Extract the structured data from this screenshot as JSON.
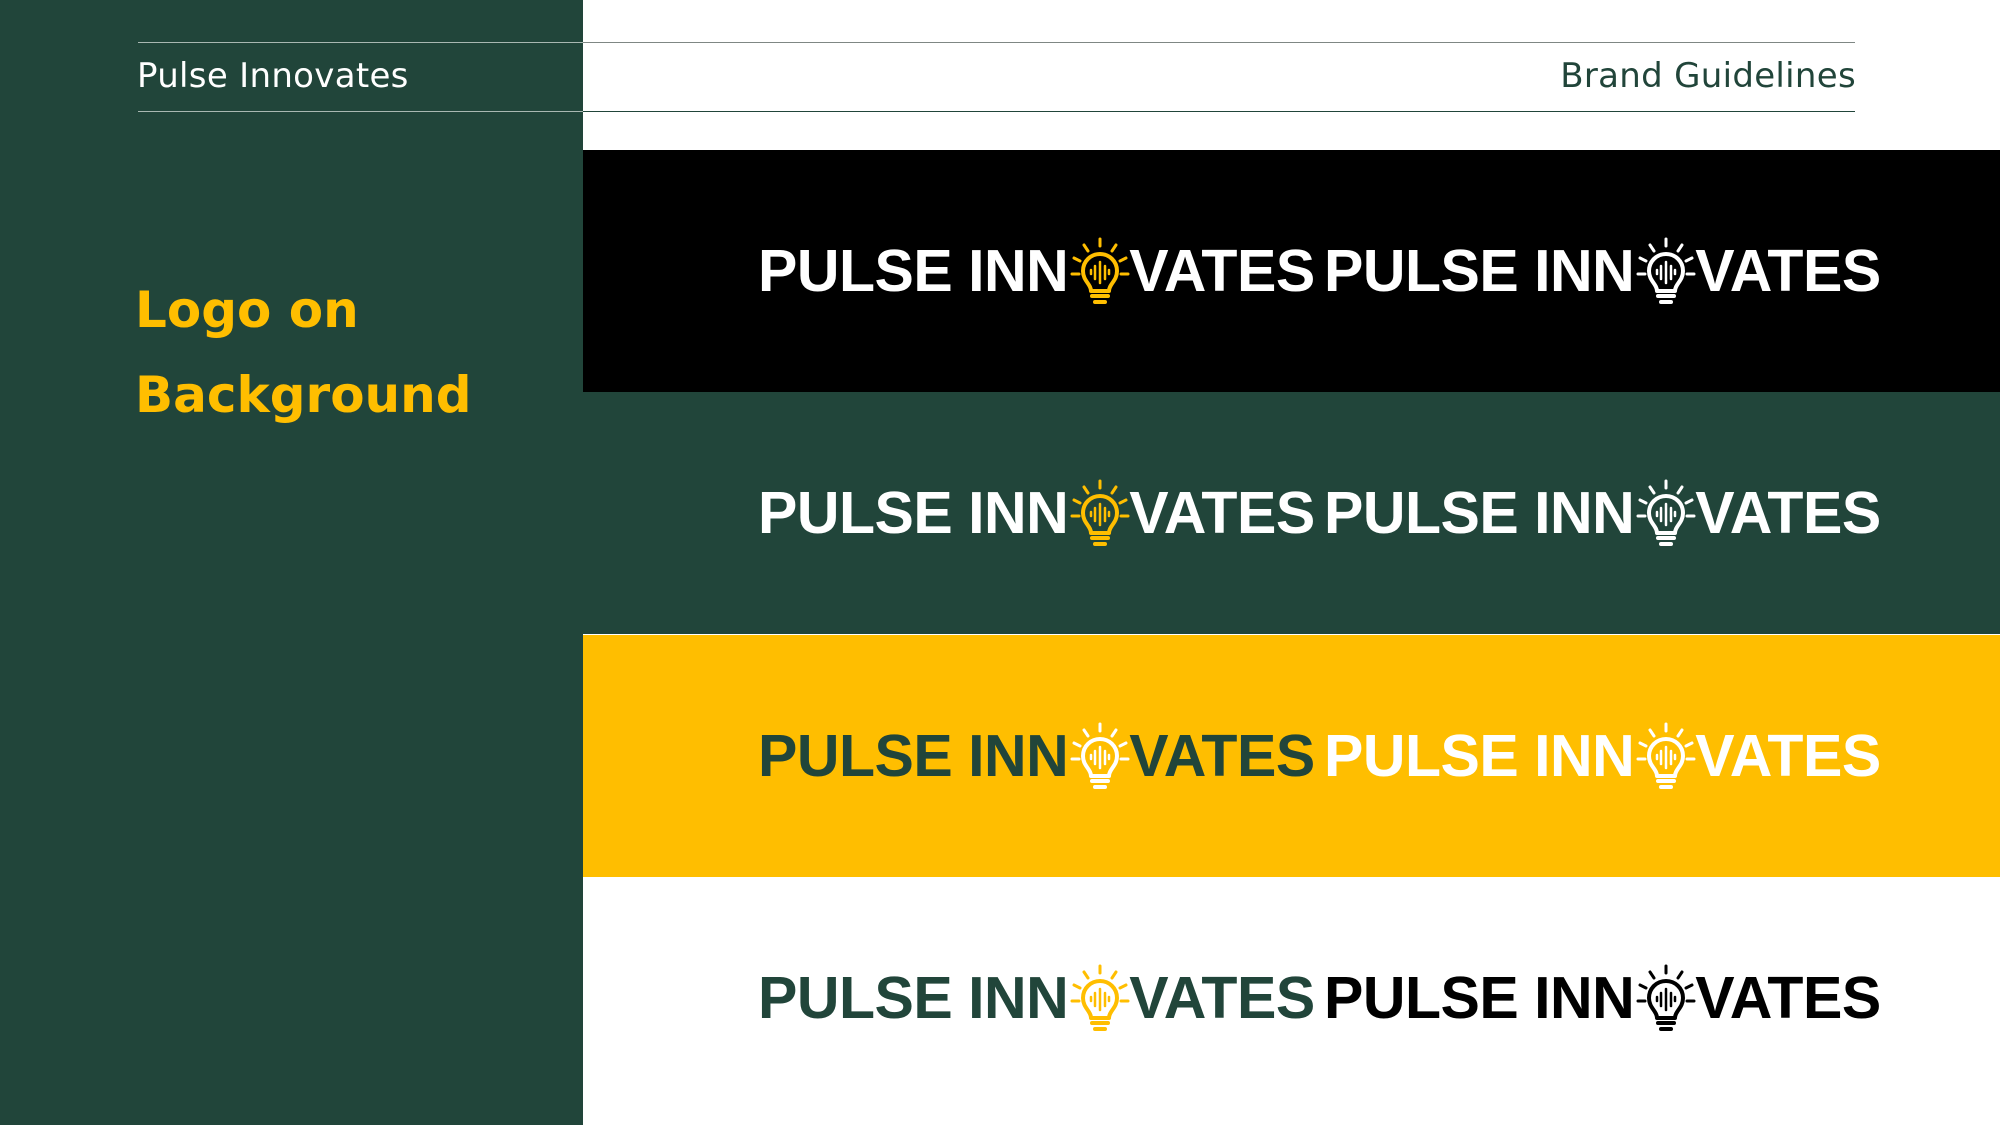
{
  "header": {
    "brand_name": "Pulse Innovates",
    "doc_title": "Brand Guidelines"
  },
  "section": {
    "title_line1": "Logo on",
    "title_line2": "Background"
  },
  "logo": {
    "left_text": "PULSE INN",
    "right_text": "VATES",
    "icon": "lightbulb-soundwave-icon"
  },
  "colors": {
    "forest_green": "#21453A",
    "brand_yellow": "#FFBE00",
    "black": "#000000",
    "white": "#FFFFFF"
  },
  "bands": [
    {
      "name": "black",
      "background": "#000000",
      "variants": [
        {
          "text": "#FFFFFF",
          "icon": "#FFBE00"
        },
        {
          "text": "#FFFFFF",
          "icon": "#FFFFFF"
        }
      ]
    },
    {
      "name": "green",
      "background": "#21453A",
      "variants": [
        {
          "text": "#FFFFFF",
          "icon": "#FFBE00"
        },
        {
          "text": "#FFFFFF",
          "icon": "#FFFFFF"
        }
      ]
    },
    {
      "name": "yellow",
      "background": "#FFBE00",
      "variants": [
        {
          "text": "#21453A",
          "icon": "#FFFFFF"
        },
        {
          "text": "#FFFFFF",
          "icon": "#FFFFFF"
        }
      ]
    },
    {
      "name": "white",
      "background": "#FFFFFF",
      "variants": [
        {
          "text": "#21453A",
          "icon": "#FFBE00"
        },
        {
          "text": "#000000",
          "icon": "#000000"
        }
      ]
    }
  ]
}
